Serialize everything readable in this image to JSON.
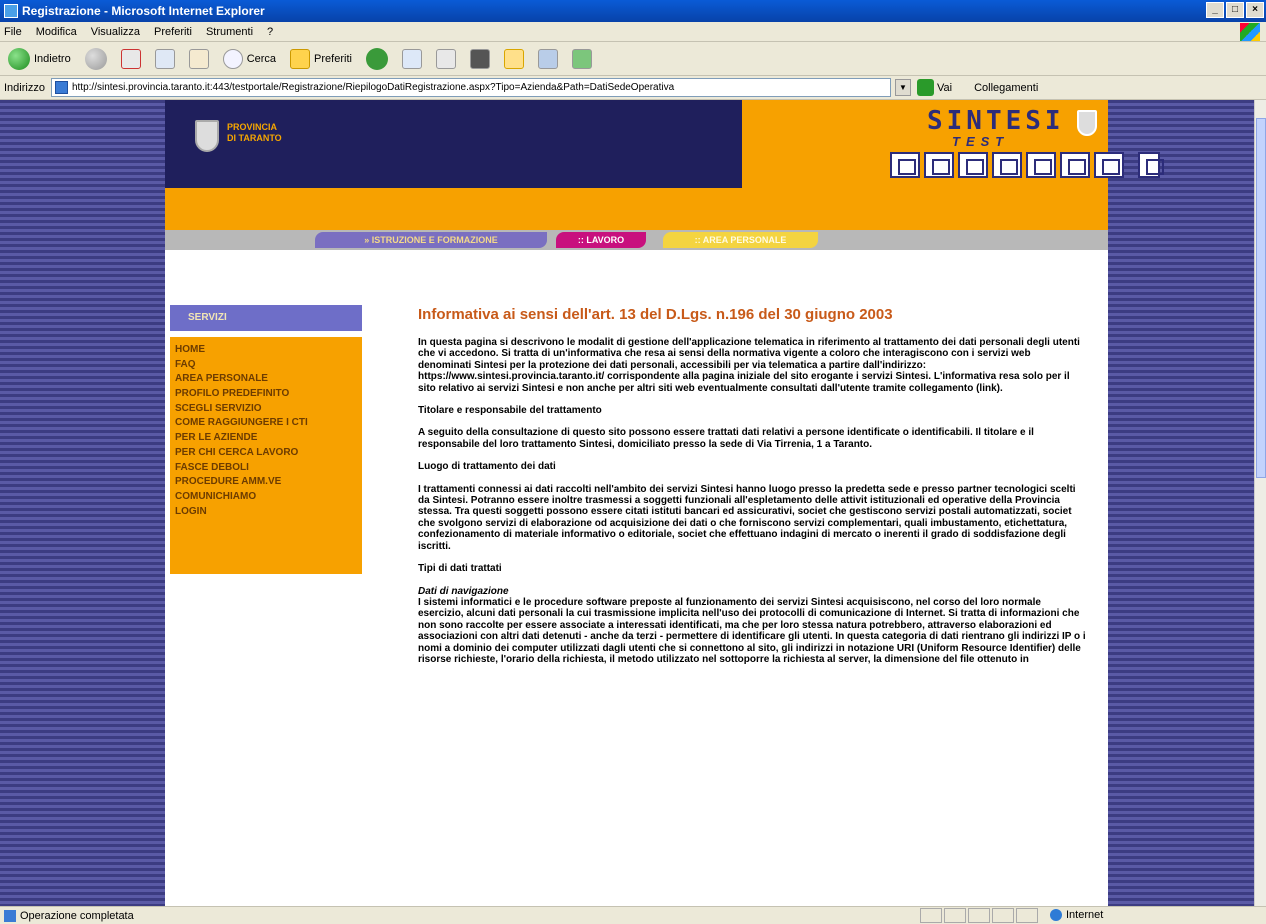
{
  "window": {
    "title": "Registrazione - Microsoft Internet Explorer"
  },
  "menu": [
    "File",
    "Modifica",
    "Visualizza",
    "Preferiti",
    "Strumenti",
    "?"
  ],
  "toolbar": {
    "back": "Indietro",
    "search": "Cerca",
    "favorites": "Preferiti"
  },
  "address": {
    "label": "Indirizzo",
    "url": "http://sintesi.provincia.taranto.it:443/testportale/Registrazione/RiepilogoDatiRegistrazione.aspx?Tipo=Azienda&Path=DatiSedeOperativa",
    "go": "Vai",
    "links": "Collegamenti"
  },
  "site": {
    "province_line1": "PROVINCIA",
    "province_line2": "DI TARANTO",
    "logo": "SINTESI",
    "logo_sub": "TEST",
    "nav": [
      "» ISTRUZIONE E FORMAZIONE",
      ":: LAVORO",
      ":: AREA PERSONALE"
    ]
  },
  "sidebar": {
    "title": "SERVIZI",
    "items": [
      "HOME",
      "FAQ",
      "AREA PERSONALE",
      "PROFILO PREDEFINITO",
      "SCEGLI SERVIZIO",
      "COME RAGGIUNGERE I CTI",
      "PER LE AZIENDE",
      "PER CHI CERCA LAVORO",
      "FASCE DEBOLI",
      "PROCEDURE AMM.VE",
      "COMUNICHIAMO",
      "LOGIN"
    ]
  },
  "content": {
    "title": "Informativa ai sensi dell'art. 13 del D.Lgs. n.196 del 30 giugno 2003",
    "p1": "In questa pagina si descrivono le modalit di gestione dell'applicazione telematica in riferimento al trattamento dei dati personali degli utenti che vi accedono. Si tratta di un'informativa che resa ai sensi della normativa vigente a coloro che interagiscono con i servizi web denominati Sintesi per la protezione dei dati personali, accessibili per via telematica a partire dall'indirizzo: https://www.sintesi.provincia.taranto.it/ corrispondente alla pagina iniziale del sito erogante i servizi Sintesi. L'informativa resa solo per il sito relativo ai servizi Sintesi e non anche per altri siti web eventualmente consultati dall'utente tramite collegamento (link).",
    "h2": "Titolare e responsabile del trattamento",
    "p2": "A seguito della consultazione di questo sito possono essere trattati dati relativi a persone identificate o identificabili. Il titolare e il responsabile del loro trattamento Sintesi, domiciliato presso la sede di Via Tirrenia, 1 a Taranto.",
    "h3": "Luogo di trattamento dei dati",
    "p3": "I trattamenti connessi ai dati raccolti nell'ambito dei servizi Sintesi hanno luogo presso la predetta sede e presso partner tecnologici scelti da Sintesi. Potranno essere inoltre trasmessi a soggetti funzionali all'espletamento delle attivit istituzionali ed operative della Provincia stessa. Tra questi soggetti possono essere citati istituti bancari ed assicurativi, societ che gestiscono servizi postali automatizzati, societ che svolgono servizi di elaborazione od acquisizione dei dati o che forniscono servizi complementari, quali imbustamento, etichettatura, confezionamento di materiale informativo o editoriale, societ che effettuano indagini di mercato o inerenti il grado di soddisfazione degli iscritti.",
    "h4": "Tipi di dati trattati",
    "sub": "Dati di navigazione",
    "p4": "I sistemi informatici e le procedure software preposte al funzionamento dei servizi Sintesi acquisiscono, nel corso del loro normale esercizio, alcuni dati personali la cui trasmissione implicita nell'uso dei protocolli di comunicazione di Internet. Si tratta di informazioni che non sono raccolte per essere associate a interessati identificati, ma che per loro stessa natura potrebbero, attraverso elaborazioni ed associazioni con altri dati detenuti - anche da terzi - permettere di identificare gli utenti. In questa categoria di dati rientrano gli indirizzi IP o i nomi a dominio dei computer utilizzati dagli utenti che si connettono al sito, gli indirizzi in notazione URI (Uniform Resource Identifier) delle risorse richieste, l'orario della richiesta, il metodo utilizzato nel sottoporre la richiesta al server, la dimensione del file ottenuto in"
  },
  "status": {
    "text": "Operazione completata",
    "zone": "Internet"
  }
}
